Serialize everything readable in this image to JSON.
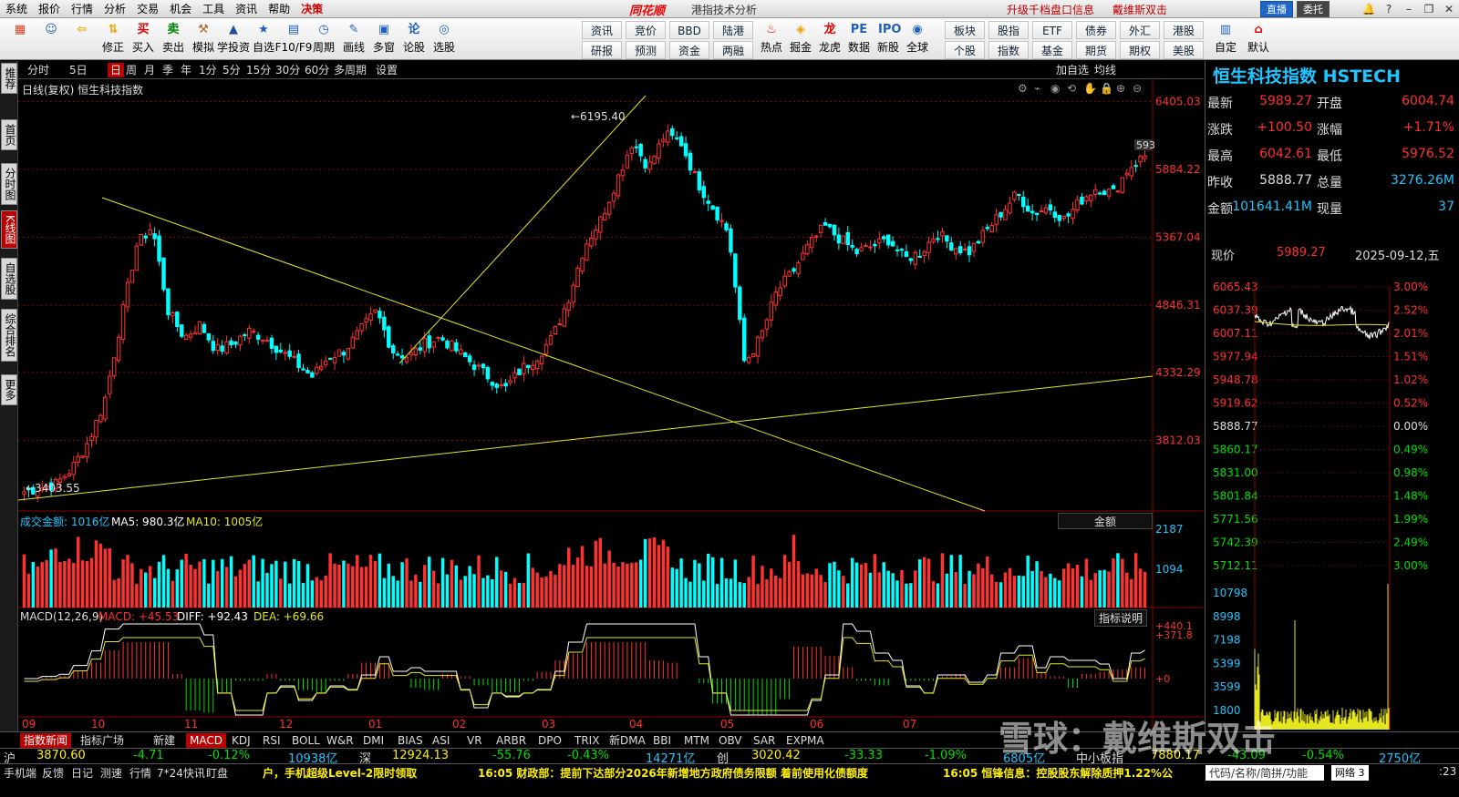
{
  "menu": {
    "items": [
      "系统",
      "报价",
      "行情",
      "分析",
      "交易",
      "机会",
      "工具",
      "资讯",
      "帮助",
      "决策"
    ],
    "app_logo": "同花顺",
    "app_title": "港指技术分析",
    "promo_1": "升级千档盘口信息",
    "promo_2": "戴维斯双击",
    "live_btn": "直播",
    "order_btn": "委托",
    "window_buttons": [
      "bell-icon",
      "help-icon",
      "minimize-icon",
      "restore-icon",
      "close-icon"
    ]
  },
  "toolbar": {
    "buttons": [
      {
        "label": "",
        "icon": "grid-icon",
        "color": "#e04020"
      },
      {
        "label": "",
        "icon": "robot-icon",
        "color": "#2060c0"
      },
      {
        "label": "",
        "icon": "back-arrow-icon",
        "color": "#f0a000"
      },
      {
        "label": "修正",
        "icon": "updown-icon",
        "color": "#f0a000"
      },
      {
        "label": "买入",
        "icon": "buy-icon",
        "color": "#e00000"
      },
      {
        "label": "卖出",
        "icon": "sell-icon",
        "color": "#008000"
      },
      {
        "label": "模拟",
        "icon": "hammer-icon",
        "color": "#b06020"
      },
      {
        "label": "学投资",
        "icon": "cap-icon",
        "color": "#2050a0"
      },
      {
        "label": "自选",
        "icon": "star-icon",
        "color": "#2060c0"
      },
      {
        "label": "F10/F9",
        "icon": "f10-icon",
        "color": "#2060c0"
      },
      {
        "label": "周期",
        "icon": "clock-icon",
        "color": "#2060c0"
      },
      {
        "label": "画线",
        "icon": "pen-icon",
        "color": "#2060c0"
      },
      {
        "label": "多窗",
        "icon": "window-icon",
        "color": "#2060c0"
      },
      {
        "label": "论股",
        "icon": "talk-icon",
        "color": "#2060c0"
      },
      {
        "label": "选股",
        "icon": "select-icon",
        "color": "#2060c0"
      }
    ],
    "grid_buttons": [
      [
        "资讯",
        "竞价",
        "BBD",
        "陆港"
      ],
      [
        "研报",
        "预测",
        "资金",
        "两融"
      ]
    ],
    "buttons_2": [
      {
        "label": "热点",
        "icon": "fire-icon",
        "color": "#e00000"
      },
      {
        "label": "掘金",
        "icon": "gold-icon",
        "color": "#f0a000"
      },
      {
        "label": "龙虎",
        "icon": "dragon-icon",
        "color": "#e00000"
      },
      {
        "label": "数据",
        "icon": "pe-icon",
        "color": "#2060c0"
      },
      {
        "label": "新股",
        "icon": "ipo-icon",
        "color": "#2060c0"
      },
      {
        "label": "全球",
        "icon": "globe-icon",
        "color": "#2060c0"
      }
    ],
    "grid_buttons_2": [
      [
        "板块",
        "股指",
        "ETF",
        "债券",
        "外汇",
        "港股"
      ],
      [
        "个股",
        "指数",
        "基金",
        "期货",
        "期权",
        "美股"
      ]
    ],
    "buttons_3": [
      {
        "label": "自定",
        "icon": "custom-icon",
        "color": "#2060c0"
      },
      {
        "label": "默认",
        "icon": "home-icon",
        "color": "#e00000"
      }
    ]
  },
  "leftnav": [
    "推荐",
    "首页",
    "分时图",
    "K线图",
    "自选股",
    "综合排名",
    "更多"
  ],
  "periodbar": {
    "items": [
      "分时",
      "5日",
      "日",
      "周",
      "月",
      "季",
      "年",
      "1分",
      "5分",
      "15分",
      "30分",
      "60分",
      "多周期",
      "设置"
    ],
    "active": "日",
    "right_items": [
      "加自选",
      "均线"
    ]
  },
  "chart": {
    "title": "日线(复权)  恒生科技指数",
    "price_ticks": [
      "6405.03",
      "5884.22",
      "5367.04",
      "4846.31",
      "4332.29",
      "3812.03"
    ],
    "high_label": "6195.40",
    "low_label": "3403.55",
    "last_label": "593",
    "volume_legend": {
      "main": "成交金额: 1016亿",
      "ma5": "MA5: 980.3亿",
      "ma10": "MA10: 1005亿",
      "selector": "金额",
      "ticks": [
        "2187",
        "1094"
      ]
    },
    "macd_legend": {
      "name": "MACD(12,26,9)",
      "macd": "MACD: +45.53",
      "diff": "DIFF: +92.43",
      "dea": "DEA: +69.66",
      "help_btn": "指标说明",
      "ticks": [
        "+440.1",
        "+371.8",
        "+0"
      ]
    },
    "months": [
      "09",
      "10",
      "11",
      "12",
      "01",
      "02",
      "03",
      "04",
      "05",
      "06",
      "07"
    ]
  },
  "chart_data": {
    "type": "candlestick",
    "title": "日线(复权)  恒生科技指数",
    "y_range": [
      3300,
      6450
    ],
    "price_ticks": [
      6405.03,
      5884.22,
      5367.04,
      4846.31,
      4332.29,
      3812.03
    ],
    "high": 6195.4,
    "low": 3403.55,
    "close_path": [
      3420,
      3450,
      3480,
      3600,
      3800,
      4100,
      4700,
      5300,
      5450,
      4800,
      4600,
      4700,
      4500,
      4550,
      4650,
      4600,
      4500,
      4400,
      4300,
      4450,
      4500,
      4650,
      4800,
      4500,
      4450,
      4550,
      4600,
      4500,
      4400,
      4300,
      4200,
      4350,
      4450,
      4600,
      4900,
      5300,
      5500,
      5800,
      6100,
      5900,
      6150,
      6100,
      5800,
      5600,
      5400,
      4400,
      4600,
      4950,
      5100,
      5300,
      5450,
      5350,
      5250,
      5300,
      5350,
      5200,
      5250,
      5400,
      5300,
      5250,
      5400,
      5550,
      5700,
      5550,
      5600,
      5500,
      5650,
      5750,
      5700,
      5900,
      5989.27
    ],
    "volume_ticks": [
      2187,
      1094
    ],
    "volume_unit": "亿",
    "macd_ticks": [
      440.1,
      371.8,
      0
    ],
    "macd": 45.53,
    "diff": 92.43,
    "dea": 69.66,
    "x_months": [
      "09",
      "10",
      "11",
      "12",
      "01",
      "02",
      "03",
      "04",
      "05",
      "06",
      "07"
    ]
  },
  "quote": {
    "title": "恒生科技指数 HSTECH",
    "rows": [
      {
        "l1": "最新",
        "v1": "5989.27",
        "l2": "开盘",
        "v2": "6004.74",
        "c1": "#ff3030",
        "c2": "#ff3030"
      },
      {
        "l1": "涨跌",
        "v1": "+100.50",
        "l2": "涨幅",
        "v2": "+1.71%",
        "c1": "#ff3030",
        "c2": "#ff3030"
      },
      {
        "l1": "最高",
        "v1": "6042.61",
        "l2": "最低",
        "v2": "5976.52",
        "c1": "#ff3030",
        "c2": "#ff3030"
      },
      {
        "l1": "昨收",
        "v1": "5888.77",
        "l2": "总量",
        "v2": "3276.26M",
        "c1": "#dddddd",
        "c2": "#1ec5ff"
      },
      {
        "l1": "金额",
        "v1": "101641.41M",
        "l2": "现量",
        "v2": "37",
        "c1": "#1ec5ff",
        "c2": "#1ec5ff"
      }
    ],
    "now_label": "现价",
    "now_value": "5989.27",
    "date": "2025-09-12,五"
  },
  "mini_chart": {
    "left_ticks": [
      "6065.43",
      "6037.39",
      "6007.11",
      "5977.94",
      "5948.78",
      "5919.62",
      "5888.77",
      "5860.17",
      "5831.00",
      "5801.84",
      "5771.56",
      "5742.39",
      "5712.11"
    ],
    "right_ticks": [
      "3.00%",
      "2.52%",
      "2.01%",
      "1.51%",
      "1.02%",
      "0.52%",
      "0.00%",
      "0.49%",
      "0.98%",
      "1.48%",
      "1.99%",
      "2.49%",
      "3.00%"
    ],
    "vol_ticks": [
      "10798",
      "8998",
      "7198",
      "5399",
      "3599",
      "1800"
    ]
  },
  "tabs": [
    "指数新闻",
    "指标广场",
    "新建",
    "MACD",
    "KDJ",
    "RSI",
    "BOLL",
    "W&R",
    "DMI",
    "BIAS",
    "ASI",
    "VR",
    "ARBR",
    "DPO",
    "TRIX",
    "新DMA",
    "BBI",
    "MTM",
    "OBV",
    "SAR",
    "EXPMA"
  ],
  "active_tab": "MACD",
  "indexbar": {
    "sh": {
      "name": "沪",
      "value": "3870.60",
      "chg": "-4.71",
      "pct": "-0.12%",
      "amt": "10938亿"
    },
    "sz": {
      "name": "深",
      "value": "12924.13",
      "chg": "-55.76",
      "pct": "-0.43%",
      "amt": "14271亿"
    },
    "cy": {
      "name": "创",
      "value": "3020.42",
      "chg": "-33.33",
      "pct": "-1.09%",
      "amt": "6805亿"
    },
    "zx": {
      "name": "中小板指",
      "value": "7880.17",
      "chg": "-43.09",
      "pct": "-0.54%",
      "amt": "2750亿"
    }
  },
  "statusbar": {
    "items": [
      "手机端",
      "反馈",
      "日记",
      "测速",
      "行情",
      "7*24快讯",
      "盯盘"
    ],
    "news_1": "户，手机超级Level-2限时领取",
    "news_2": "16:05 财政部：提前下达部分2026年新增地方政府债务限额 着前使用化债额度",
    "news_3": "16:05 恒锋信息：控股股东解除质押1.22%公",
    "search": "代码/名称/简拼/功能",
    "network": "网络 3",
    "time": ":23"
  },
  "watermark": "雪球：戴维斯双击"
}
